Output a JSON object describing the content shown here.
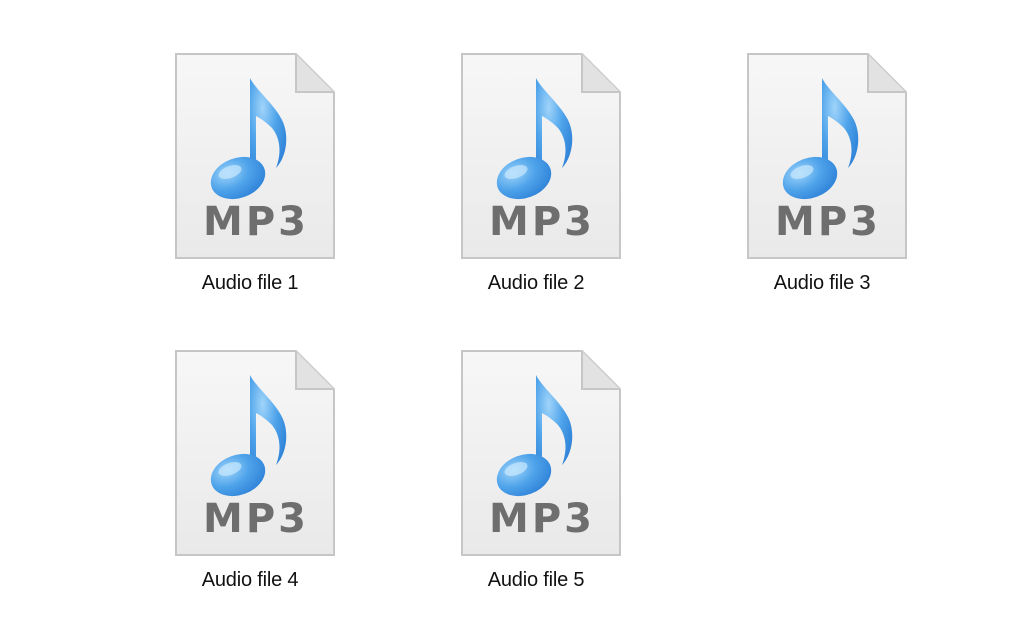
{
  "files": [
    {
      "name": "Audio file 1",
      "type_label": "MP3",
      "icon": "mp3-file-icon"
    },
    {
      "name": "Audio file 2",
      "type_label": "MP3",
      "icon": "mp3-file-icon"
    },
    {
      "name": "Audio file 3",
      "type_label": "MP3",
      "icon": "mp3-file-icon"
    },
    {
      "name": "Audio file 4",
      "type_label": "MP3",
      "icon": "mp3-file-icon"
    },
    {
      "name": "Audio file 5",
      "type_label": "MP3",
      "icon": "mp3-file-icon"
    }
  ],
  "colors": {
    "note_blue": "#3b8fe0",
    "note_light": "#8cc8f5",
    "label_gray": "#707070",
    "page_bg": "#f1f1f1",
    "page_border": "#c8c8c8"
  }
}
